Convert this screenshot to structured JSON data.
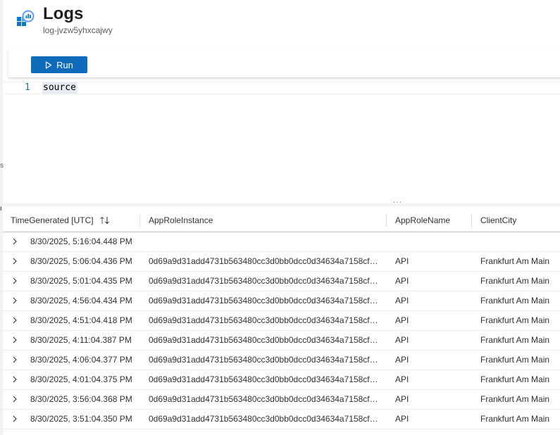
{
  "header": {
    "title": "Logs",
    "subtitle": "log-jvzw5yhxcajwy",
    "icon": "azure-logs-icon"
  },
  "toolbar": {
    "run_label": "Run",
    "run_icon": "play-icon",
    "accent": "#0f6cbd"
  },
  "editor": {
    "line_number": "1",
    "query": "source"
  },
  "left_edge": {
    "mark_s": "s",
    "mark_i": "ı"
  },
  "results": {
    "splitter_dots": "···",
    "columns": [
      {
        "label": "TimeGenerated [UTC]",
        "sort_icon": "sort-updown-icon"
      },
      {
        "label": "AppRoleInstance"
      },
      {
        "label": "AppRoleName"
      },
      {
        "label": "ClientCity"
      }
    ],
    "rows": [
      {
        "time": "8/30/2025, 5:16:04.448 PM",
        "instance": "",
        "name": "",
        "city": ""
      },
      {
        "time": "8/30/2025, 5:06:04.436 PM",
        "instance": "0d69a9d31add4731b563480cc3d0bb0dcc0d34634a7158cfa…",
        "name": "API",
        "city": "Frankfurt Am Main"
      },
      {
        "time": "8/30/2025, 5:01:04.435 PM",
        "instance": "0d69a9d31add4731b563480cc3d0bb0dcc0d34634a7158cfa…",
        "name": "API",
        "city": "Frankfurt Am Main"
      },
      {
        "time": "8/30/2025, 4:56:04.434 PM",
        "instance": "0d69a9d31add4731b563480cc3d0bb0dcc0d34634a7158cfa…",
        "name": "API",
        "city": "Frankfurt Am Main"
      },
      {
        "time": "8/30/2025, 4:51:04.418 PM",
        "instance": "0d69a9d31add4731b563480cc3d0bb0dcc0d34634a7158cfa…",
        "name": "API",
        "city": "Frankfurt Am Main"
      },
      {
        "time": "8/30/2025, 4:11:04.387 PM",
        "instance": "0d69a9d31add4731b563480cc3d0bb0dcc0d34634a7158cfa…",
        "name": "API",
        "city": "Frankfurt Am Main"
      },
      {
        "time": "8/30/2025, 4:06:04.377 PM",
        "instance": "0d69a9d31add4731b563480cc3d0bb0dcc0d34634a7158cfa…",
        "name": "API",
        "city": "Frankfurt Am Main"
      },
      {
        "time": "8/30/2025, 4:01:04.375 PM",
        "instance": "0d69a9d31add4731b563480cc3d0bb0dcc0d34634a7158cfa…",
        "name": "API",
        "city": "Frankfurt Am Main"
      },
      {
        "time": "8/30/2025, 3:56:04.368 PM",
        "instance": "0d69a9d31add4731b563480cc3d0bb0dcc0d34634a7158cfa…",
        "name": "API",
        "city": "Frankfurt Am Main"
      },
      {
        "time": "8/30/2025, 3:51:04.350 PM",
        "instance": "0d69a9d31add4731b563480cc3d0bb0dcc0d34634a7158cfa…",
        "name": "API",
        "city": "Frankfurt Am Main"
      }
    ]
  }
}
